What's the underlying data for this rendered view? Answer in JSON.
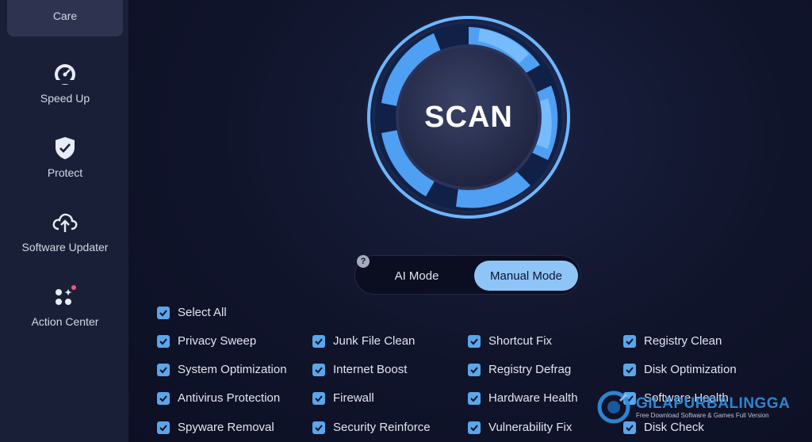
{
  "sidebar": {
    "items": [
      {
        "label": "Care",
        "icon": "care-icon",
        "active": true
      },
      {
        "label": "Speed Up",
        "icon": "speedometer-icon",
        "active": false
      },
      {
        "label": "Protect",
        "icon": "shield-check-icon",
        "active": false
      },
      {
        "label": "Software Updater",
        "icon": "cloud-upload-icon",
        "active": false
      },
      {
        "label": "Action Center",
        "icon": "apps-grid-icon",
        "active": false,
        "badge": true
      }
    ]
  },
  "scan": {
    "label": "SCAN"
  },
  "mode": {
    "help": "?",
    "options": [
      "AI Mode",
      "Manual Mode"
    ],
    "selected": "Manual Mode"
  },
  "checklist": {
    "select_all": "Select All",
    "items": [
      [
        "Privacy Sweep",
        "Junk File Clean",
        "Shortcut Fix",
        "Registry Clean"
      ],
      [
        "System Optimization",
        "Internet Boost",
        "Registry Defrag",
        "Disk Optimization"
      ],
      [
        "Antivirus Protection",
        "Firewall",
        "Hardware Health",
        "Software Health"
      ],
      [
        "Spyware Removal",
        "Security Reinforce",
        "Vulnerability Fix",
        "Disk Check"
      ]
    ]
  },
  "watermark": {
    "title": "GILAPURBALINGGA",
    "subtitle": "Free Download Software & Games Full Version"
  },
  "colors": {
    "accent": "#5ba6ea",
    "toggle_active": "#8fc4f6",
    "sidebar_bg": "#1a1f38",
    "main_bg": "#0e1127"
  }
}
